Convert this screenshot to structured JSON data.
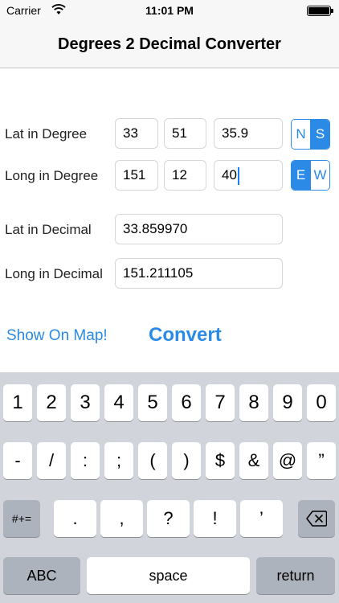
{
  "status_bar": {
    "carrier": "Carrier",
    "time": "11:01 PM"
  },
  "nav": {
    "title": "Degrees 2 Decimal Converter"
  },
  "form": {
    "lat_label": "Lat in Degree",
    "lat_deg": "33",
    "lat_min": "51",
    "lat_sec": "35.9",
    "lat_hemisphere": {
      "options": [
        "N",
        "S"
      ],
      "selected": "S"
    },
    "long_label": "Long in Degree",
    "long_deg": "151",
    "long_min": "12",
    "long_sec": "40",
    "long_hemisphere": {
      "options": [
        "E",
        "W"
      ],
      "selected": "E"
    },
    "lat_decimal_label": "Lat in Decimal",
    "lat_decimal_value": "33.859970",
    "long_decimal_label": "Long in Decimal",
    "long_decimal_value": "151.211105"
  },
  "actions": {
    "show_map": "Show On Map!",
    "convert": "Convert"
  },
  "keyboard": {
    "row1": [
      "1",
      "2",
      "3",
      "4",
      "5",
      "6",
      "7",
      "8",
      "9",
      "0"
    ],
    "row2": [
      "-",
      "/",
      ":",
      ";",
      "(",
      ")",
      "$",
      "&",
      "@",
      "”"
    ],
    "row3": [
      ".",
      ",",
      "?",
      "!",
      "’"
    ],
    "mode_key": "#+=",
    "abc_key": "ABC",
    "space_key": "space",
    "return_key": "return"
  },
  "icons": {
    "wifi": "wifi-icon",
    "battery": "battery-icon",
    "delete": "backspace-icon"
  },
  "colors": {
    "accent": "#2a8ae5",
    "keyboard_bg": "#d1d5db",
    "bar_bg": "#f7f7f7"
  }
}
